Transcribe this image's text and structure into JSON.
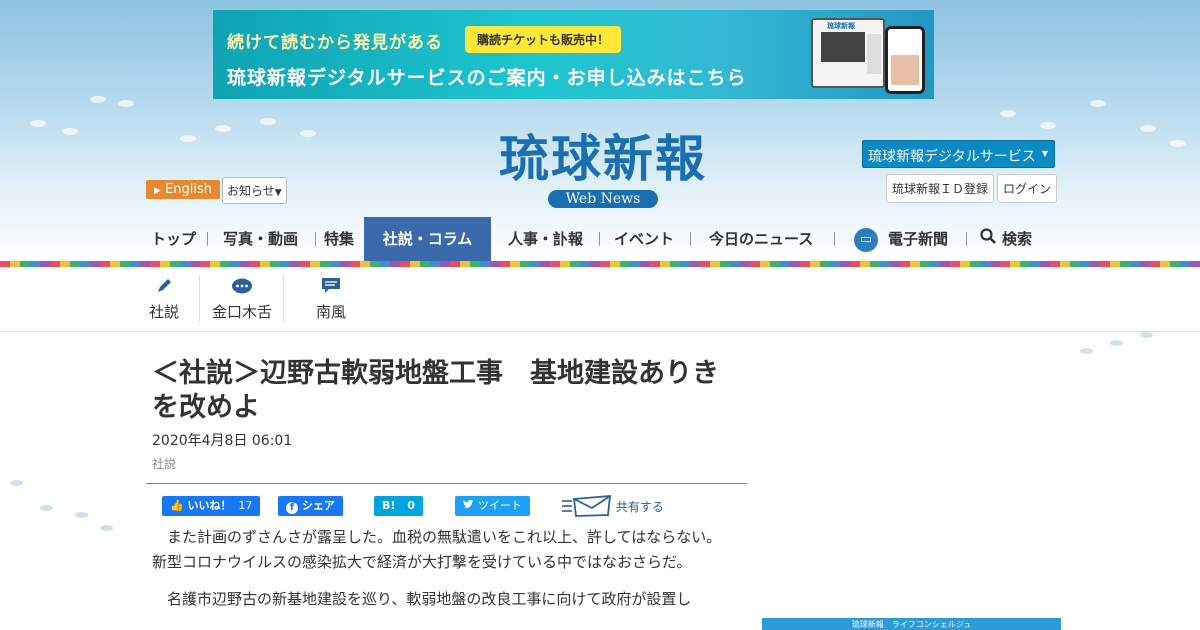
{
  "banner": {
    "line1": "続けて読むから発見がある",
    "pill": "購読チケットも販売中！",
    "line2": "琉球新報デジタルサービスのご案内・お申し込みはこちら",
    "mini_logo": "琉球新報"
  },
  "header": {
    "logo": "琉球新報",
    "logo_sub": "Web News",
    "english": "English",
    "info": "お知らせ",
    "digital": "琉球新報デジタルサービス",
    "register": "琉球新報ＩＤ登録",
    "login": "ログイン"
  },
  "nav": {
    "top": "トップ",
    "photo": "写真・動画",
    "special": "特集",
    "editorial": "社説・コラム",
    "people": "人事・訃報",
    "event": "イベント",
    "today": "今日のニュース",
    "epaper": "電子新聞",
    "search": "検索"
  },
  "subnav": {
    "editorial": "社説",
    "column": "金口木舌",
    "nanpu": "南風"
  },
  "article": {
    "title": "＜社説＞辺野古軟弱地盤工事　基地建設ありきを改めよ",
    "date": "2020年4月8日 06:01",
    "category": "社説",
    "p1": "また計画のずさんさが露呈した。血税の無駄遣いをこれ以上、許してはならない。新型コロナウイルスの感染拡大で経済が大打撃を受けている中ではなおさらだ。",
    "p2": "名護市辺野古の新基地建設を巡り、軟弱地盤の改良工事に向けて政府が設置し"
  },
  "social": {
    "like": "いいね！",
    "like_count": "17",
    "fb_share": "シェア",
    "hatena": "B!",
    "hatena_count": "0",
    "tweet": "ツイート",
    "share": "共有する"
  },
  "sidebar": {
    "box_label": "琉球新報　ライフコンシェルジュ"
  },
  "colors": {
    "brand": "#1a6fb0",
    "nav_active": "#3b6aaa",
    "english_btn": "#e68a2e",
    "facebook": "#1877f2",
    "twitter": "#1da1f2",
    "hatena": "#00a4de"
  }
}
